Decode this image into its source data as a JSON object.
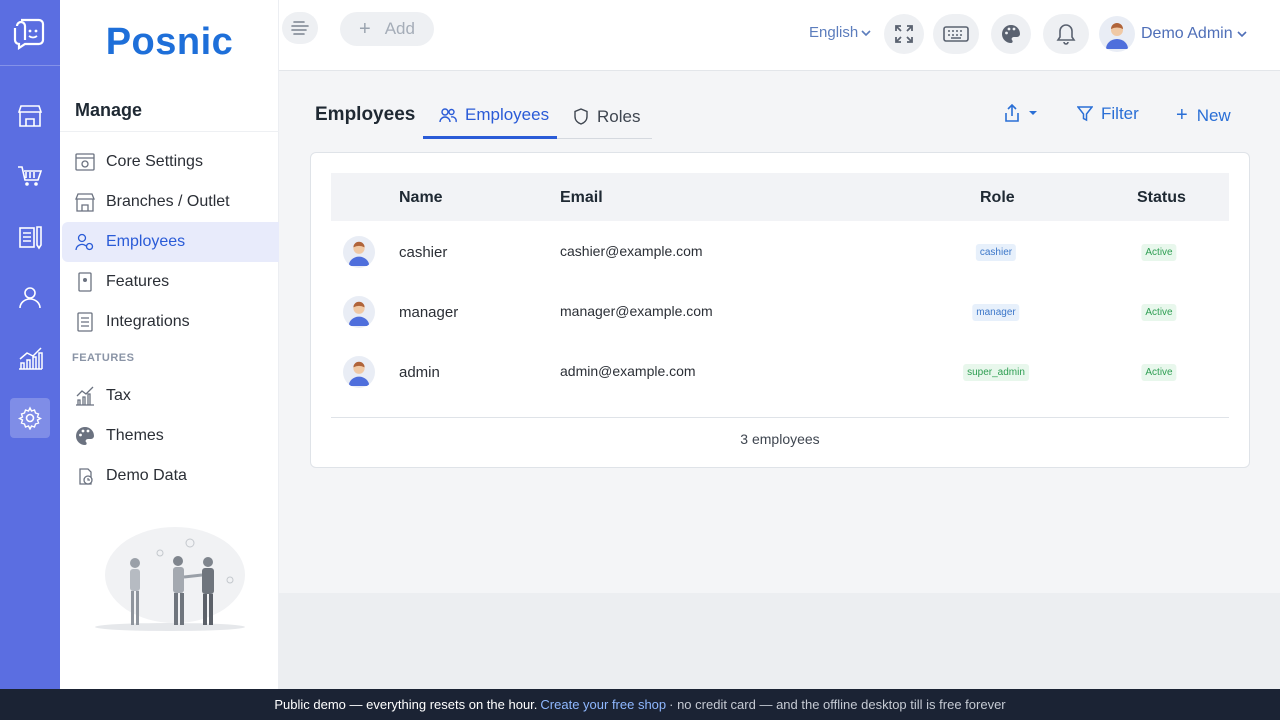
{
  "app": {
    "brand": "Posnic"
  },
  "header": {
    "add_label": "Add",
    "language": "English",
    "user_name": "Demo Admin"
  },
  "sidebar": {
    "title": "Manage",
    "items": [
      {
        "label": "Core Settings",
        "icon": "settings-panel-icon"
      },
      {
        "label": "Branches / Outlet",
        "icon": "store-icon"
      },
      {
        "label": "Employees",
        "icon": "employees-gear-icon",
        "active": true
      },
      {
        "label": "Features",
        "icon": "features-icon"
      },
      {
        "label": "Integrations",
        "icon": "integrations-icon"
      }
    ],
    "section_label": "FEATURES",
    "feature_items": [
      {
        "label": "Tax",
        "icon": "tax-chart-icon"
      },
      {
        "label": "Themes",
        "icon": "palette-icon"
      },
      {
        "label": "Demo Data",
        "icon": "demo-data-icon"
      }
    ]
  },
  "page": {
    "title": "Employees",
    "tabs": [
      {
        "label": "Employees",
        "active": true
      },
      {
        "label": "Roles",
        "active": false
      }
    ],
    "actions": {
      "filter": "Filter",
      "new": "New"
    }
  },
  "table": {
    "columns": [
      "Name",
      "Email",
      "Role",
      "Status"
    ],
    "rows": [
      {
        "name": "cashier",
        "email": "cashier@example.com",
        "role": "cashier",
        "status": "Active"
      },
      {
        "name": "manager",
        "email": "manager@example.com",
        "role": "manager",
        "status": "Active"
      },
      {
        "name": "admin",
        "email": "admin@example.com",
        "role": "super_admin",
        "status": "Active"
      }
    ],
    "footer": "3 employees"
  },
  "banner": {
    "text": "Public demo — everything resets on the hour.",
    "link": "Create your free shop",
    "tail": "· no credit card — and the offline desktop till is free forever"
  },
  "colors": {
    "rail": "#5b6ee1",
    "brand": "#1e6fd9",
    "accent": "#2a5bd7",
    "status_active": "#2e9e52",
    "banner": "#1b2334"
  }
}
